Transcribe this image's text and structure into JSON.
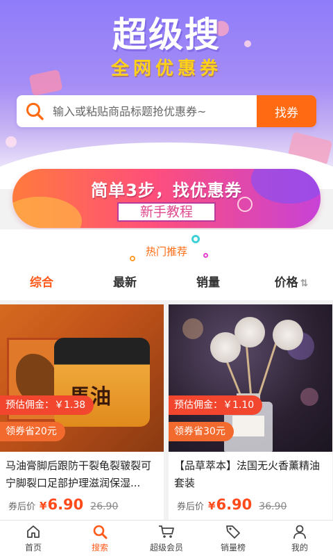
{
  "hero": {
    "title": "超级搜",
    "subtitle": "全网优惠券"
  },
  "search": {
    "placeholder": "输入或粘贴商品标题抢优惠券~",
    "button_label": "找券",
    "icon": "search-icon"
  },
  "banner": {
    "title": "简单3步，找优惠券",
    "button_label": "新手教程"
  },
  "section": {
    "hot_title": "热门推荐"
  },
  "sort_tabs": [
    {
      "label": "综合",
      "active": true
    },
    {
      "label": "最新",
      "active": false
    },
    {
      "label": "销量",
      "active": false
    },
    {
      "label": "价格",
      "active": false,
      "icon": "sort-icon"
    }
  ],
  "products": [
    {
      "title": "马油膏脚后跟防干裂龟裂皲裂可宁脚裂口足部护理滋润保湿...",
      "commission": "预估佣金：￥1.38",
      "coupon": "领券省20元",
      "price_label": "券后价",
      "currency": "¥",
      "price": "6.90",
      "original_price": "26.90",
      "image_text": "馬油"
    },
    {
      "title": "【品草萃本】法国无火香薰精油套装",
      "commission": "预估佣金：￥1.10",
      "coupon": "领券省30元",
      "price_label": "券后价",
      "currency": "¥",
      "price": "6.90",
      "original_price": "36.90"
    }
  ],
  "bottom_nav": [
    {
      "label": "首页",
      "icon": "home-icon",
      "active": false
    },
    {
      "label": "搜索",
      "icon": "search-icon",
      "active": true
    },
    {
      "label": "超级会员",
      "icon": "cart-icon",
      "active": false
    },
    {
      "label": "销量榜",
      "icon": "tag-icon",
      "active": false
    },
    {
      "label": "我的",
      "icon": "user-icon",
      "active": false
    }
  ],
  "colors": {
    "accent": "#ff5a1a",
    "search_button": "#ff6a12",
    "commission_tag": "#f2462e",
    "coupon_tag": "#f36a2f",
    "hero_title": "#ffffff",
    "hero_subtitle": "#ffd21a"
  }
}
